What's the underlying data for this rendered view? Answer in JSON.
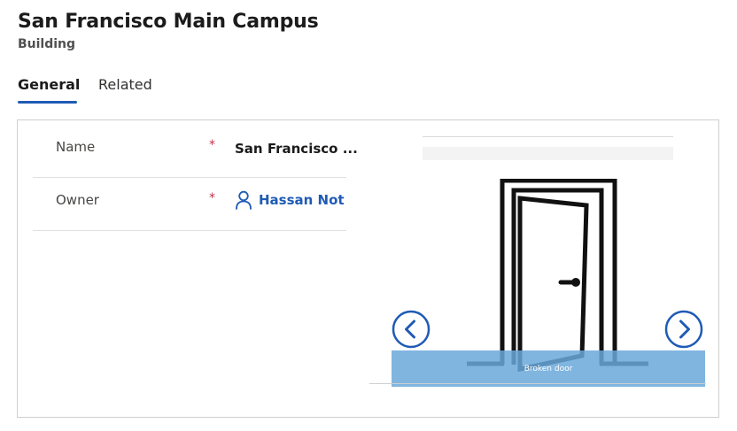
{
  "record": {
    "title": "San Francisco Main Campus",
    "entity_type": "Building"
  },
  "tabs": [
    {
      "label": "General",
      "selected": true
    },
    {
      "label": "Related",
      "selected": false
    }
  ],
  "fields": [
    {
      "label": "Name",
      "required_marker": "*",
      "value": "San Francisco ..."
    },
    {
      "label": "Owner",
      "required_marker": "*",
      "value": "Hassan Not",
      "icon": "person-icon"
    }
  ],
  "image_viewer": {
    "caption": "Broken door",
    "prev_icon": "chevron-left-circle-icon",
    "next_icon": "chevron-right-circle-icon"
  },
  "colors": {
    "accent": "#1f5bb5",
    "required": "#c4314b",
    "caption_bar": "#6aa8db"
  }
}
